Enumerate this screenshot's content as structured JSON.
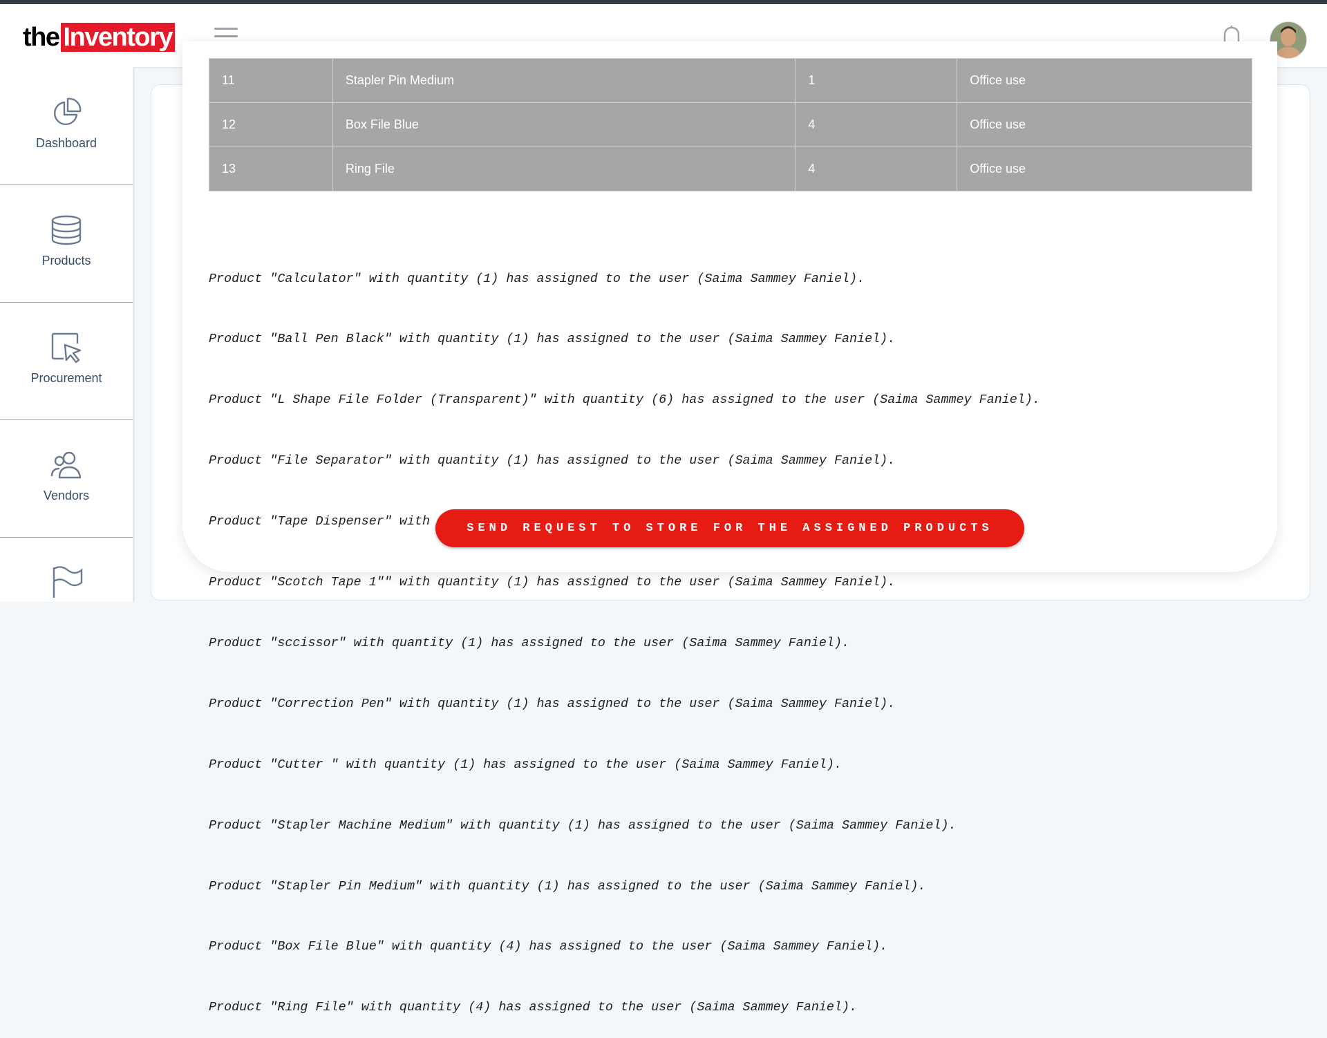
{
  "header": {
    "logo_prefix": "the",
    "logo_brand": "Inventory",
    "menu_icon": "hamburger-menu-icon",
    "bell_icon": "bell-icon",
    "avatar_icon": "user-avatar"
  },
  "sidebar": {
    "items": [
      {
        "label": "Dashboard",
        "icon": "pie-chart-icon"
      },
      {
        "label": "Products",
        "icon": "database-icon"
      },
      {
        "label": "Procurement",
        "icon": "cursor-pointer-icon"
      },
      {
        "label": "Vendors",
        "icon": "users-icon"
      },
      {
        "label": "",
        "icon": "flag-icon"
      }
    ]
  },
  "table": {
    "rows": [
      [
        "11",
        "Stapler Pin Medium",
        "1",
        "Office use"
      ],
      [
        "12",
        "Box File Blue",
        "4",
        "Office use"
      ],
      [
        "13",
        "Ring File",
        "4",
        "Office use"
      ]
    ]
  },
  "log_lines": [
    "Product \"Calculator\" with quantity (1) has assigned to the user (Saima Sammey Faniel).",
    "Product \"Ball Pen Black\" with quantity (1) has assigned to the user (Saima Sammey Faniel).",
    "Product \"L Shape File Folder (Transparent)\" with quantity (6) has assigned to the user (Saima Sammey Faniel).",
    "Product \"File Separator\" with quantity (1) has assigned to the user (Saima Sammey Faniel).",
    "Product \"Tape Dispenser\" with quantity (1) has assigned to the user (Saima Sammey Faniel).",
    "Product \"Scotch Tape 1\"\" with quantity (1) has assigned to the user (Saima Sammey Faniel).",
    "Product \"sccissor\" with quantity (1) has assigned to the user (Saima Sammey Faniel).",
    "Product \"Correction Pen\" with quantity (1) has assigned to the user (Saima Sammey Faniel).",
    "Product \"Cutter \" with quantity (1) has assigned to the user (Saima Sammey Faniel).",
    "Product \"Stapler Machine Medium\" with quantity (1) has assigned to the user (Saima Sammey Faniel).",
    "Product \"Stapler Pin Medium\" with quantity (1) has assigned to the user (Saima Sammey Faniel).",
    "Product \"Box File Blue\" with quantity (4) has assigned to the user (Saima Sammey Faniel).",
    "Product \"Ring File\" with quantity (4) has assigned to the user (Saima Sammey Faniel)."
  ],
  "send_button": {
    "label": "SEND REQUEST TO STORE FOR THE ASSIGNED PRODUCTS"
  },
  "colors": {
    "brand_red": "#e51b2b",
    "table_gray": "#a6a6a6",
    "button_red": "#e51b14"
  }
}
